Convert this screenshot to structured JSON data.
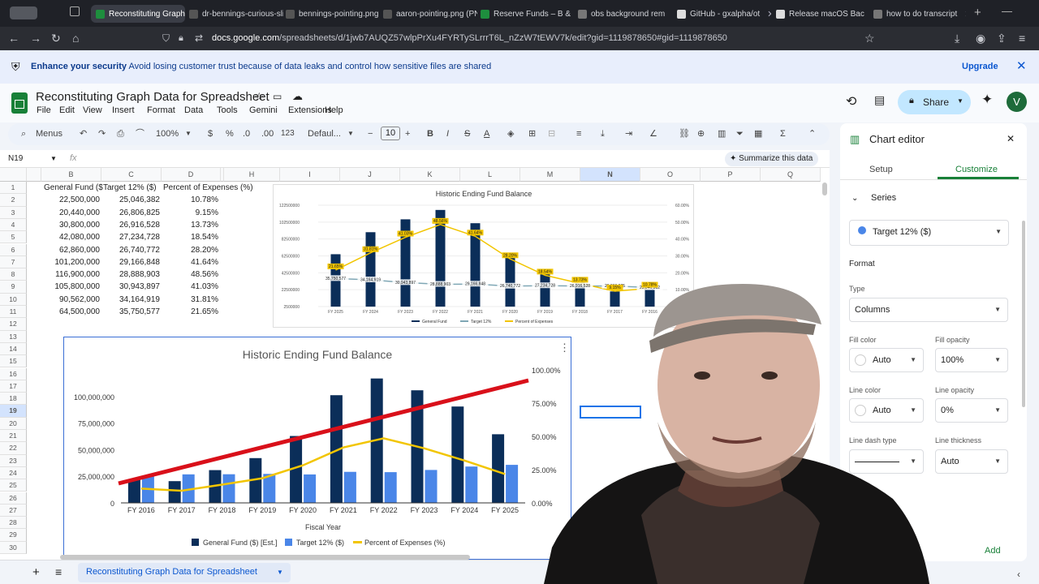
{
  "browser": {
    "tabs": [
      {
        "label": "Reconstituting Graph",
        "active": true,
        "color": "#1e8e3e"
      },
      {
        "label": "dr-bennings-curious-sli",
        "color": "#555"
      },
      {
        "label": "bennings-pointing.png (",
        "color": "#555"
      },
      {
        "label": "aaron-pointing.png (PN",
        "color": "#555"
      },
      {
        "label": "Reserve Funds – B &",
        "color": "#1e8e3e"
      },
      {
        "label": "obs background rem",
        "color": "#777"
      },
      {
        "label": "GitHub - gxalpha/ot",
        "color": "#ddd"
      },
      {
        "label": "Release macOS Bac",
        "color": "#ddd"
      },
      {
        "label": "how to do transcript",
        "color": "#777"
      }
    ],
    "url_domain": "docs.google.com",
    "url_path": "/spreadsheets/d/1jwb7AUQZ57wlpPrXu4FYRTySLrrrT6L_nZzW7tEWV7k/edit?gid=1119878650#gid=1119878650"
  },
  "banner": {
    "bold": "Enhance your security",
    "text": "Avoid losing customer trust because of data leaks and control how sensitive files are shared",
    "upgrade": "Upgrade"
  },
  "doc": {
    "title": "Reconstituting Graph Data for Spreadsheet",
    "menus": [
      "File",
      "Edit",
      "View",
      "Insert",
      "Format",
      "Data",
      "Tools",
      "Gemini",
      "Extensions",
      "Help"
    ],
    "share": "Share",
    "avatar": "V"
  },
  "toolbar": {
    "menus": "Menus",
    "zoom": "100%",
    "currency": "$",
    "percent": "%",
    "dec_dec": ".0",
    "inc_dec": ".00",
    "num_fmt": "123",
    "font": "Defaul...",
    "font_size": "10"
  },
  "formula_bar": {
    "cell_ref": "N19",
    "fx": "fx",
    "summarize": "Summarize this data"
  },
  "grid": {
    "columns": [
      "B",
      "C",
      "D",
      "",
      "H",
      "I",
      "J",
      "K",
      "L",
      "M",
      "N",
      "O",
      "P",
      "Q"
    ],
    "rows": [
      "1",
      "2",
      "3",
      "4",
      "5",
      "6",
      "7",
      "8",
      "9",
      "10",
      "11",
      "12",
      "13",
      "14",
      "15",
      "16",
      "17",
      "18",
      "19",
      "20",
      "21",
      "22",
      "23",
      "24",
      "25",
      "26",
      "27",
      "28",
      "29",
      "30"
    ],
    "headers": [
      "General Fund ($",
      "Target 12% ($)",
      "Percent of Expenses (%)"
    ],
    "data": [
      [
        "22,500,000",
        "25,046,382",
        "10.78%"
      ],
      [
        "20,440,000",
        "26,806,825",
        "9.15%"
      ],
      [
        "30,800,000",
        "26,916,528",
        "13.73%"
      ],
      [
        "42,080,000",
        "27,234,728",
        "18.54%"
      ],
      [
        "62,860,000",
        "26,740,772",
        "28.20%"
      ],
      [
        "101,200,000",
        "29,166,848",
        "41.64%"
      ],
      [
        "116,900,000",
        "28,888,903",
        "48.56%"
      ],
      [
        "105,800,000",
        "30,943,897",
        "41.03%"
      ],
      [
        "90,562,000",
        "34,164,919",
        "31.81%"
      ],
      [
        "64,500,000",
        "35,750,577",
        "21.65%"
      ]
    ]
  },
  "sheet_tab": "Reconstituting Graph Data for Spreadsheet",
  "editor": {
    "title": "Chart editor",
    "tab_setup": "Setup",
    "tab_customize": "Customize",
    "section": "Series",
    "series_selected": "Target 12% ($)",
    "format": "Format",
    "type_label": "Type",
    "type_value": "Columns",
    "fill_color_label": "Fill color",
    "fill_color_value": "Auto",
    "fill_opacity_label": "Fill opacity",
    "fill_opacity_value": "100%",
    "line_color_label": "Line color",
    "line_color_value": "Auto",
    "line_opacity_label": "Line opacity",
    "line_opacity_value": "0%",
    "line_dash_label": "Line dash type",
    "line_thickness_label": "Line thickness",
    "line_thickness_value": "Auto",
    "add": "Add"
  },
  "chart_data": [
    {
      "type": "bar",
      "title": "Historic Ending Fund Balance",
      "categories": [
        "FY 2025",
        "FY 2024",
        "FY 2023",
        "FY 2022",
        "FY 2021",
        "FY 2020",
        "FY 2019",
        "FY 2018",
        "FY 2017",
        "FY 2016"
      ],
      "series": [
        {
          "name": "General Fund",
          "type": "bar",
          "color": "#0b2e59",
          "values": [
            64500000,
            90562000,
            105800000,
            116900000,
            101200000,
            62860000,
            42080000,
            30800000,
            20440000,
            22500000
          ]
        },
        {
          "name": "Target 12%",
          "type": "line",
          "color": "#7fa7b5",
          "values": [
            35750577,
            34164919,
            30943897,
            28888903,
            29166848,
            26740772,
            27234728,
            26916528,
            26806825,
            25046382
          ]
        },
        {
          "name": "Percent of Expenses",
          "type": "line",
          "axis": "right",
          "color": "#f2c500",
          "values": [
            21.65,
            31.81,
            41.03,
            48.56,
            41.64,
            28.2,
            18.54,
            13.73,
            9.15,
            10.78
          ]
        }
      ],
      "point_labels_target": [
        "35,750,577",
        "34,164,919",
        "30,943,897",
        "28,888,903",
        "29,166,848",
        "26,740,772",
        "27,234,728",
        "26,916,528",
        "26,806,825",
        "25,046,382"
      ],
      "point_labels_pct": [
        "21.65%",
        "31.81%",
        "41.03%",
        "48.56%",
        "41.64%",
        "28.20%",
        "18.54%",
        "13.73%",
        "9.15%",
        "10.78%"
      ],
      "yticks_left": [
        "2500000",
        "22500000",
        "42500000",
        "62500000",
        "82500000",
        "102500000",
        "122500000"
      ],
      "yticks_right": [
        "0.00%",
        "10.00%",
        "20.00%",
        "30.00%",
        "40.00%",
        "50.00%",
        "60.00%"
      ],
      "ylim": [
        2500000,
        122500000
      ],
      "ylim_right": [
        0,
        60
      ],
      "legend_position": "bottom"
    },
    {
      "type": "bar",
      "title": "Historic Ending Fund Balance",
      "xlabel": "Fiscal Year",
      "categories": [
        "FY 2016",
        "FY 2017",
        "FY 2018",
        "FY 2019",
        "FY 2020",
        "FY 2021",
        "FY 2022",
        "FY 2023",
        "FY 2024",
        "FY 2025"
      ],
      "series": [
        {
          "name": "General Fund ($) [Est.]",
          "type": "bar",
          "color": "#0b2e59",
          "values": [
            22500000,
            20440000,
            30800000,
            42080000,
            62860000,
            101200000,
            116900000,
            105800000,
            90562000,
            64500000
          ]
        },
        {
          "name": "Target 12% ($)",
          "type": "bar",
          "color": "#4a86e8",
          "values": [
            25046382,
            26806825,
            26916528,
            27234728,
            26740772,
            29166848,
            28888903,
            30943897,
            34164919,
            35750577
          ]
        },
        {
          "name": "Percent of Expenses (%)",
          "type": "line",
          "axis": "right",
          "color": "#f2c500",
          "values": [
            10.78,
            9.15,
            13.73,
            18.54,
            28.2,
            41.64,
            48.56,
            41.03,
            31.81,
            21.65
          ]
        }
      ],
      "yticks_left": [
        "0",
        "25,000,000",
        "50,000,000",
        "75,000,000",
        "100,000,000"
      ],
      "yticks_right": [
        "0.00%",
        "25.00%",
        "50.00%",
        "75.00%",
        "100.00%"
      ],
      "ylim": [
        0,
        125000000
      ],
      "ylim_right": [
        0,
        100
      ],
      "legend_position": "bottom",
      "annotation": {
        "type": "trend-arrow",
        "color": "#d9101a"
      }
    }
  ]
}
